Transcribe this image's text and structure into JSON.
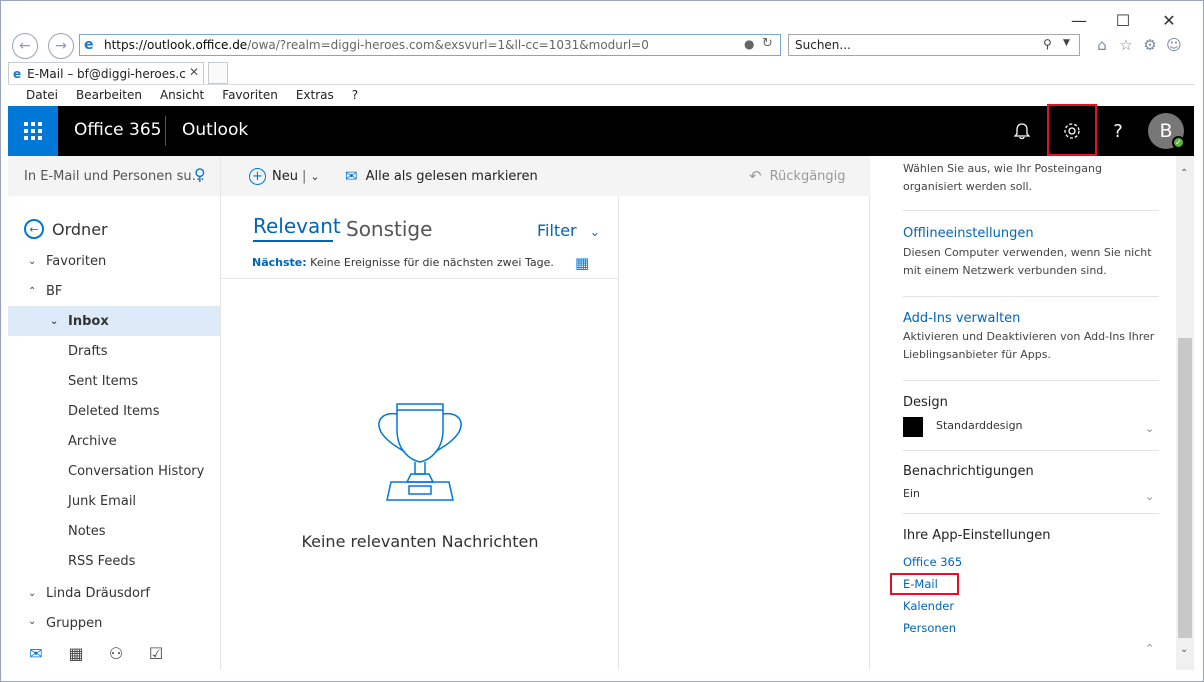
{
  "browser": {
    "url_host": "https://outlook.",
    "url_domain": "office.de",
    "url_path": "/owa/?realm=diggi-heroes.com&exsvurl=1&ll-cc=1031&modurl=0",
    "search_placeholder": "Suchen...",
    "tab_title": "E-Mail – bf@diggi-heroes.c",
    "window_controls": [
      "minimize-icon",
      "maximize-icon",
      "close-icon"
    ],
    "menu": [
      "Datei",
      "Bearbeiten",
      "Ansicht",
      "Favoriten",
      "Extras",
      "?"
    ]
  },
  "header": {
    "app_suite": "Office 365",
    "app_name": "Outlook",
    "avatar_initial": "B",
    "help_label": "?",
    "accent_color": "#0078d7"
  },
  "leftnav": {
    "search_placeholder": "In E-Mail und Personen su…",
    "folders_title": "Ordner",
    "favorites": "Favoriten",
    "account": "BF",
    "folders": [
      {
        "label": "Inbox",
        "selected": true
      },
      {
        "label": "Drafts"
      },
      {
        "label": "Sent Items"
      },
      {
        "label": "Deleted Items"
      },
      {
        "label": "Archive"
      },
      {
        "label": "Conversation History"
      },
      {
        "label": "Junk Email"
      },
      {
        "label": "Notes"
      },
      {
        "label": "RSS Feeds"
      }
    ],
    "other_account": "Linda Dräusdorf",
    "groups_partial": "Gruppen"
  },
  "commandbar": {
    "new_label": "Neu",
    "mark_all_read": "Alle als gelesen markieren",
    "undo": "Rückgängig"
  },
  "msglist": {
    "tab_focused": "Relevant",
    "tab_other": "Sonstige",
    "filter": "Filter",
    "upcoming_label": "Nächste:",
    "upcoming_text": "Keine Ereignisse für die nächsten zwei Tage.",
    "empty_text": "Keine relevanten Nachrichten"
  },
  "settings": {
    "focused_desc": "Wählen Sie aus, wie Ihr Posteingang organisiert werden soll.",
    "offline_title": "Offlineeinstellungen",
    "offline_desc": "Diesen Computer verwenden, wenn Sie nicht mit einem Netzwerk verbunden sind.",
    "addins_title": "Add-Ins verwalten",
    "addins_desc": "Aktivieren und Deaktivieren von Add-Ins Ihrer Lieblingsanbieter für Apps.",
    "design_title": "Design",
    "design_value": "Standarddesign",
    "notif_title": "Benachrichtigungen",
    "notif_value": "Ein",
    "app_settings_title": "Ihre App-Einstellungen",
    "app_links": [
      "Office 365",
      "E-Mail",
      "Kalender",
      "Personen"
    ]
  }
}
